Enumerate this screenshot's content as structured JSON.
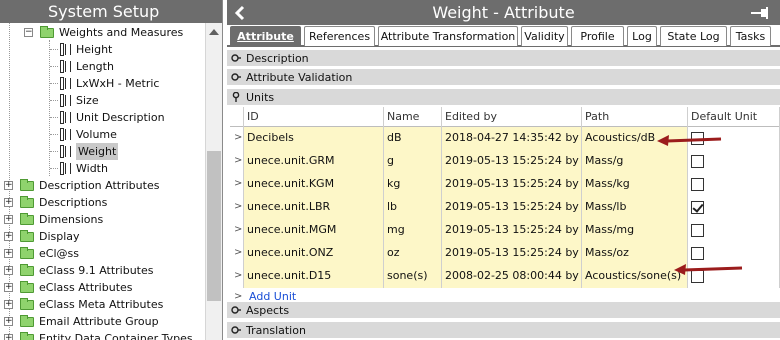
{
  "left_panel": {
    "title": "System Setup",
    "tree": [
      {
        "label": "Weights and Measures",
        "kind": "folder",
        "expander": "−"
      },
      {
        "label": "Height",
        "kind": "unit"
      },
      {
        "label": "Length",
        "kind": "unit"
      },
      {
        "label": "LxWxH - Metric",
        "kind": "unit"
      },
      {
        "label": "Size",
        "kind": "unit"
      },
      {
        "label": "Unit Description",
        "kind": "unit"
      },
      {
        "label": "Volume",
        "kind": "unit"
      },
      {
        "label": "Weight",
        "kind": "unit",
        "selected": true
      },
      {
        "label": "Width",
        "kind": "unit"
      },
      {
        "label": "Description Attributes",
        "kind": "folder",
        "expander": "+"
      },
      {
        "label": "Descriptions",
        "kind": "folder",
        "expander": "+"
      },
      {
        "label": "Dimensions",
        "kind": "folder",
        "expander": "+"
      },
      {
        "label": "Display",
        "kind": "folder",
        "expander": "+"
      },
      {
        "label": "eCl@ss",
        "kind": "folder",
        "expander": "+"
      },
      {
        "label": "eClass 9.1 Attributes",
        "kind": "folder",
        "expander": "+"
      },
      {
        "label": "eClass Attributes",
        "kind": "folder",
        "expander": "+"
      },
      {
        "label": "eClass Meta Attributes",
        "kind": "folder",
        "expander": "+"
      },
      {
        "label": "Email Attribute Group",
        "kind": "folder",
        "expander": "+"
      },
      {
        "label": "Entity Data Container Types",
        "kind": "folder",
        "expander": "+"
      }
    ]
  },
  "right_panel": {
    "title": "Weight - Attribute",
    "tabs": [
      "Attribute",
      "References",
      "Attribute Transformation",
      "Validity",
      "Profile",
      "Log",
      "State Log",
      "Tasks"
    ],
    "active_tab": "Attribute",
    "sections_top": [
      "Description",
      "Attribute Validation",
      "Units"
    ],
    "sections_bottom": [
      "Aspects",
      "Translation"
    ],
    "units_table": {
      "columns": [
        "ID",
        "Name",
        "Edited by",
        "Path",
        "Default Unit"
      ],
      "rows": [
        {
          "id": "Decibels",
          "name": "dB",
          "edited_by": "2018-04-27 14:35:42 by ...",
          "path": "Acoustics/dB",
          "default": false
        },
        {
          "id": "unece.unit.GRM",
          "name": "g",
          "edited_by": "2019-05-13 15:25:24 by ...",
          "path": "Mass/g",
          "default": false
        },
        {
          "id": "unece.unit.KGM",
          "name": "kg",
          "edited_by": "2019-05-13 15:25:24 by ...",
          "path": "Mass/kg",
          "default": false
        },
        {
          "id": "unece.unit.LBR",
          "name": "lb",
          "edited_by": "2019-05-13 15:25:24 by ...",
          "path": "Mass/lb",
          "default": true
        },
        {
          "id": "unece.unit.MGM",
          "name": "mg",
          "edited_by": "2019-05-13 15:25:24 by ...",
          "path": "Mass/mg",
          "default": false
        },
        {
          "id": "unece.unit.ONZ",
          "name": "oz",
          "edited_by": "2019-05-13 15:25:24 by ...",
          "path": "Mass/oz",
          "default": false
        },
        {
          "id": "unece.unit.D15",
          "name": "sone(s)",
          "edited_by": "2008-02-25 08:00:44 by S...",
          "path": "Acoustics/sone(s)",
          "default": false
        }
      ],
      "row_lead_glyph": ">",
      "add_label": "Add Unit"
    }
  },
  "colors": {
    "header_gray": "#6d6d6d",
    "row_highlight": "#fdf7c8",
    "annotation_arrow": "#9b1c1c",
    "folder_green": "#8fd36d",
    "link_blue": "#1a4fd6"
  }
}
